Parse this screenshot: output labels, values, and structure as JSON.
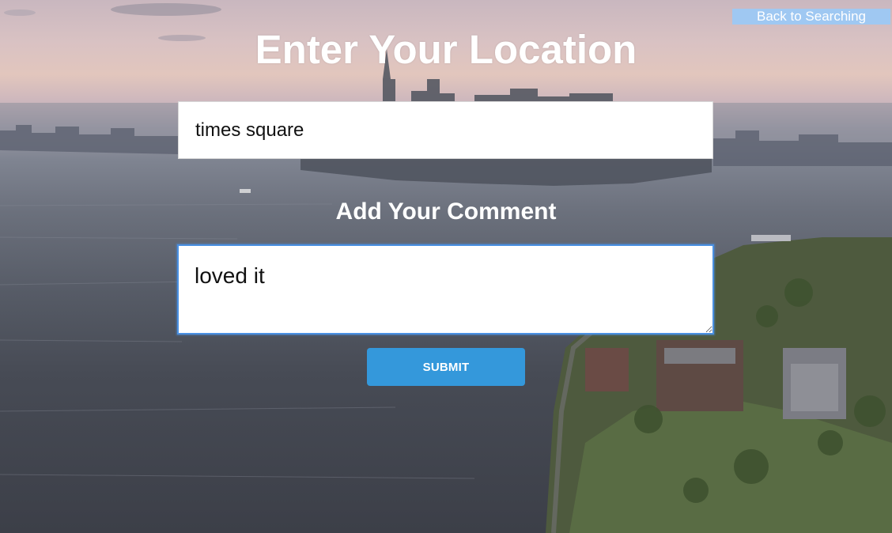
{
  "header": {
    "back_label": "Back to Searching",
    "title": "Enter Your Location"
  },
  "form": {
    "location_value": "times square",
    "comment_heading": "Add Your Comment",
    "comment_value": "loved it",
    "submit_label": "SUBMIT"
  },
  "colors": {
    "back_button_bg": "#9fc8f2",
    "submit_bg": "#3498db",
    "focus_border": "#4a90e2"
  }
}
